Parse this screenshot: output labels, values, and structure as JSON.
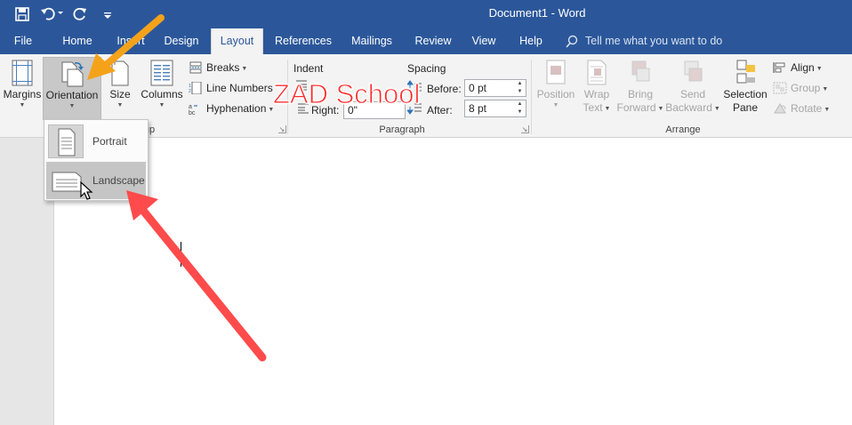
{
  "title_bar": {
    "document_title": "Document1  -  Word",
    "icons": [
      "save-icon",
      "undo-icon",
      "redo-icon",
      "customize-qat-icon"
    ]
  },
  "tabs": [
    {
      "label": "File",
      "active": false
    },
    {
      "label": "Home",
      "active": false
    },
    {
      "label": "Insert",
      "active": false
    },
    {
      "label": "Design",
      "active": false
    },
    {
      "label": "Layout",
      "active": true
    },
    {
      "label": "References",
      "active": false
    },
    {
      "label": "Mailings",
      "active": false
    },
    {
      "label": "Review",
      "active": false
    },
    {
      "label": "View",
      "active": false
    },
    {
      "label": "Help",
      "active": false
    }
  ],
  "tell_me": {
    "placeholder": "Tell me what you want to do"
  },
  "page_setup": {
    "group_label": "Page Setup",
    "group_label_visible": "up",
    "margins": "Margins",
    "orientation": "Orientation",
    "size": "Size",
    "columns": "Columns",
    "breaks": "Breaks",
    "line_numbers": "Line Numbers",
    "hyphenation": "Hyphenation"
  },
  "paragraph": {
    "group_label": "Paragraph",
    "indent_label": "Indent",
    "spacing_label": "Spacing",
    "indent_right_label": "Right:",
    "indent_right_value": "0\"",
    "before_label": "Before:",
    "before_value": "0 pt",
    "after_label": "After:",
    "after_value": "8 pt"
  },
  "arrange": {
    "group_label": "Arrange",
    "position": "Position",
    "wrap_text_1": "Wrap",
    "wrap_text_2": "Text",
    "bring_forward_1": "Bring",
    "bring_forward_2": "Forward",
    "send_backward_1": "Send",
    "send_backward_2": "Backward",
    "selection_pane_1": "Selection",
    "selection_pane_2": "Pane",
    "align": "Align",
    "group": "Group",
    "rotate": "Rotate"
  },
  "orientation_menu": {
    "items": [
      {
        "label": "Portrait",
        "hovered": false
      },
      {
        "label": "Landscape",
        "hovered": true
      }
    ]
  },
  "watermark": "ZAD School",
  "colors": {
    "word_blue": "#2b579a",
    "ribbon_bg": "#f3f3f3",
    "arrow_orange": "#f5a21b",
    "arrow_red": "#ff4b4b",
    "watermark_red": "#ff2b2b"
  }
}
